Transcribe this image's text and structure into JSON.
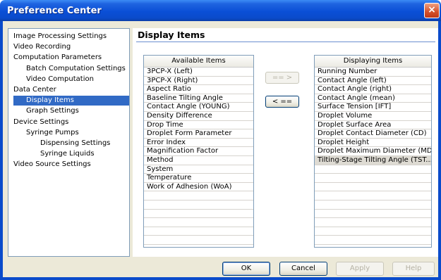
{
  "window": {
    "title": "Preference Center",
    "close_glyph": "×"
  },
  "tree": {
    "items": [
      {
        "label": "Image Processing Settings",
        "level": 0
      },
      {
        "label": "Video Recording",
        "level": 0
      },
      {
        "label": "Computation Parameters",
        "level": 0
      },
      {
        "label": "Batch Computation Settings",
        "level": 1
      },
      {
        "label": "Video Computation",
        "level": 1
      },
      {
        "label": "Data Center",
        "level": 0
      },
      {
        "label": "Display Items",
        "level": 1,
        "selected": true
      },
      {
        "label": "Graph Settings",
        "level": 1
      },
      {
        "label": "Device Settings",
        "level": 0
      },
      {
        "label": "Syringe Pumps",
        "level": 1
      },
      {
        "label": "Dispensing Settings",
        "level": 2
      },
      {
        "label": "Syringe Liquids",
        "level": 2
      },
      {
        "label": "Video Source Settings",
        "level": 0
      }
    ]
  },
  "panel": {
    "title": "Display Items",
    "available": {
      "header": "Available Items",
      "items": [
        "3PCP-X (Left)",
        "3PCP-X (Right)",
        "Aspect Ratio",
        "Baseline Tilting Angle",
        "Contact Angle (YOUNG)",
        "Density Difference",
        "Drop Time",
        "Droplet Form Parameter",
        "Error Index",
        "Magnification Factor",
        "Method",
        "System",
        "Temperature",
        "Work of Adhesion (WoA)"
      ]
    },
    "displaying": {
      "header": "Displaying Items",
      "items": [
        "Running Number",
        "Contact Angle (left)",
        "Contact Angle (right)",
        "Contact Angle (mean)",
        "Surface Tension [IFT]",
        "Droplet Volume",
        "Droplet Surface Area",
        "Droplet Contact Diameter (CD)",
        "Droplet Height",
        "Droplet Maximum Diameter (MD)",
        "Tilting-Stage Tilting Angle (TST..."
      ],
      "highlighted_index": 10
    },
    "add_button": "== >",
    "remove_button": "< =="
  },
  "footer": {
    "ok": "OK",
    "cancel": "Cancel",
    "apply": "Apply",
    "help": "Help"
  }
}
